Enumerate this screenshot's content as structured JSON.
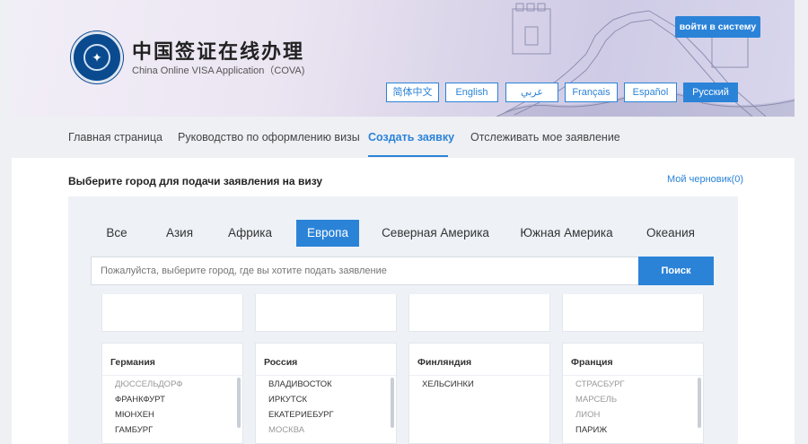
{
  "header": {
    "title": "中国签证在线办理",
    "subtitle": "China Online VISA Application（COVA)",
    "login_label": "войти в систему"
  },
  "languages": [
    {
      "label": "简体中文",
      "active": false
    },
    {
      "label": "English",
      "active": false
    },
    {
      "label": "عربي",
      "active": false
    },
    {
      "label": "Français",
      "active": false
    },
    {
      "label": "Español",
      "active": false
    },
    {
      "label": "Русский",
      "active": true
    }
  ],
  "nav": {
    "items": [
      {
        "label": "Главная страница"
      },
      {
        "label": "Руководство по оформлению визы"
      },
      {
        "label": "Создать заявку"
      },
      {
        "label": "Отслеживать мое заявление"
      }
    ]
  },
  "main": {
    "title": "Выберите город для подачи заявления на визу",
    "draft_link": "Мой черновик(0)"
  },
  "regions": [
    {
      "label": "Все"
    },
    {
      "label": "Азия"
    },
    {
      "label": "Африка"
    },
    {
      "label": "Европа"
    },
    {
      "label": "Северная Америка"
    },
    {
      "label": "Южная Америка"
    },
    {
      "label": "Океания"
    }
  ],
  "search": {
    "placeholder": "Пожалуйста, выберите город, где вы хотите подать заявление",
    "button_label": "Поиск"
  },
  "countries": [
    {
      "name": "Германия",
      "cities": [
        "ДЮССЕЛЬДОРФ",
        "ФРАНКФУРТ",
        "МЮНХЕН",
        "ГАМБУРГ"
      ]
    },
    {
      "name": "Россия",
      "cities": [
        "ВЛАДИВОСТОК",
        "ИРКУТСК",
        "ЕКАТЕРИЕБУРГ",
        "МОСКВА"
      ]
    },
    {
      "name": "Финляндия",
      "cities": [
        "ХЕЛЬСИНКИ"
      ]
    },
    {
      "name": "Франция",
      "cities": [
        "СТРАСБУРГ",
        "МАРСЕЛЬ",
        "ЛИОН",
        "ПАРИЖ"
      ]
    }
  ],
  "colors": {
    "accent": "#2b83d8"
  }
}
